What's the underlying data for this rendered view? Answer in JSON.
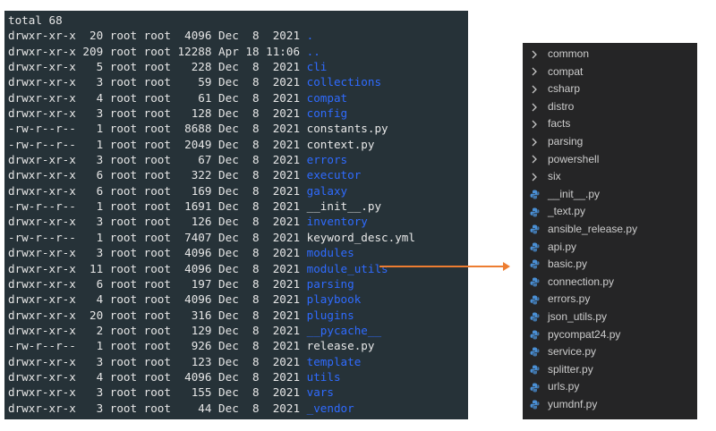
{
  "terminal": {
    "lines": [
      {
        "meta": "total 68",
        "name": "",
        "type": "header"
      },
      {
        "meta": "drwxr-xr-x  20 root root  4096 Dec  8  2021 ",
        "name": ".",
        "type": "dir"
      },
      {
        "meta": "drwxr-xr-x 209 root root 12288 Apr 18 11:06 ",
        "name": "..",
        "type": "dir"
      },
      {
        "meta": "drwxr-xr-x   5 root root   228 Dec  8  2021 ",
        "name": "cli",
        "type": "dir"
      },
      {
        "meta": "drwxr-xr-x   3 root root    59 Dec  8  2021 ",
        "name": "collections",
        "type": "dir"
      },
      {
        "meta": "drwxr-xr-x   4 root root    61 Dec  8  2021 ",
        "name": "compat",
        "type": "dir"
      },
      {
        "meta": "drwxr-xr-x   3 root root   128 Dec  8  2021 ",
        "name": "config",
        "type": "dir"
      },
      {
        "meta": "-rw-r--r--   1 root root  8688 Dec  8  2021 ",
        "name": "constants.py",
        "type": "file"
      },
      {
        "meta": "-rw-r--r--   1 root root  2049 Dec  8  2021 ",
        "name": "context.py",
        "type": "file"
      },
      {
        "meta": "drwxr-xr-x   3 root root    67 Dec  8  2021 ",
        "name": "errors",
        "type": "dir"
      },
      {
        "meta": "drwxr-xr-x   6 root root   322 Dec  8  2021 ",
        "name": "executor",
        "type": "dir"
      },
      {
        "meta": "drwxr-xr-x   6 root root   169 Dec  8  2021 ",
        "name": "galaxy",
        "type": "dir"
      },
      {
        "meta": "-rw-r--r--   1 root root  1691 Dec  8  2021 ",
        "name": "__init__.py",
        "type": "file"
      },
      {
        "meta": "drwxr-xr-x   3 root root   126 Dec  8  2021 ",
        "name": "inventory",
        "type": "dir"
      },
      {
        "meta": "-rw-r--r--   1 root root  7407 Dec  8  2021 ",
        "name": "keyword_desc.yml",
        "type": "file"
      },
      {
        "meta": "drwxr-xr-x   3 root root  4096 Dec  8  2021 ",
        "name": "modules",
        "type": "dir"
      },
      {
        "meta": "drwxr-xr-x  11 root root  4096 Dec  8  2021 ",
        "name": "module_utils",
        "type": "dir"
      },
      {
        "meta": "drwxr-xr-x   6 root root   197 Dec  8  2021 ",
        "name": "parsing",
        "type": "dir"
      },
      {
        "meta": "drwxr-xr-x   4 root root  4096 Dec  8  2021 ",
        "name": "playbook",
        "type": "dir"
      },
      {
        "meta": "drwxr-xr-x  20 root root   316 Dec  8  2021 ",
        "name": "plugins",
        "type": "dir"
      },
      {
        "meta": "drwxr-xr-x   2 root root   129 Dec  8  2021 ",
        "name": "__pycache__",
        "type": "dir"
      },
      {
        "meta": "-rw-r--r--   1 root root   926 Dec  8  2021 ",
        "name": "release.py",
        "type": "file"
      },
      {
        "meta": "drwxr-xr-x   3 root root   123 Dec  8  2021 ",
        "name": "template",
        "type": "dir"
      },
      {
        "meta": "drwxr-xr-x   4 root root  4096 Dec  8  2021 ",
        "name": "utils",
        "type": "dir"
      },
      {
        "meta": "drwxr-xr-x   3 root root   155 Dec  8  2021 ",
        "name": "vars",
        "type": "dir"
      },
      {
        "meta": "drwxr-xr-x   3 root root    44 Dec  8  2021 ",
        "name": "_vendor",
        "type": "dir"
      }
    ]
  },
  "explorer": {
    "folders": [
      "common",
      "compat",
      "csharp",
      "distro",
      "facts",
      "parsing",
      "powershell",
      "six"
    ],
    "files": [
      "__init__.py",
      "_text.py",
      "ansible_release.py",
      "api.py",
      "basic.py",
      "connection.py",
      "errors.py",
      "json_utils.py",
      "pycompat24.py",
      "service.py",
      "splitter.py",
      "urls.py",
      "yumdnf.py"
    ]
  },
  "colors": {
    "terminal_bg": "#263238",
    "directory": "#2f6bff",
    "arrow": "#ed7d31",
    "explorer_bg": "#252526",
    "python_icon": "#4a8fd4"
  }
}
